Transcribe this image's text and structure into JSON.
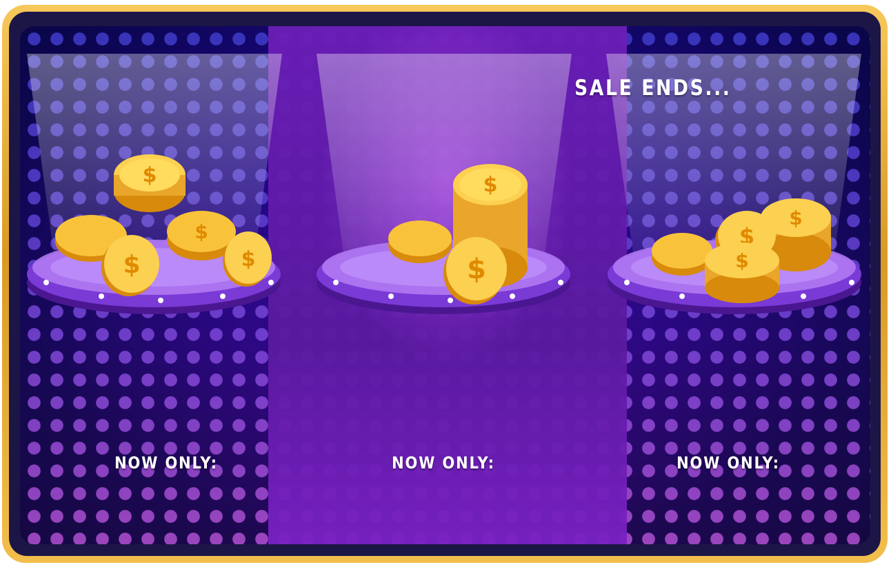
{
  "sale": {
    "title": "SALE ENDS..."
  },
  "packs": [
    {
      "price_label": "NOW ONLY:",
      "coin_stack": "large-coin-pile"
    },
    {
      "price_label": "NOW ONLY:",
      "coin_stack": "tall-coin-stack"
    },
    {
      "price_label": "NOW ONLY:",
      "coin_stack": "small-coin-pile"
    }
  ],
  "colors": {
    "frame_gold": "#e4a937",
    "panel_purple": "#6a1fb2",
    "dot_blue": "#3e3ac9",
    "dot_pink": "#b04fd0",
    "coin_gold": "#f5b51e",
    "pedestal_violet": "#a463f0"
  }
}
